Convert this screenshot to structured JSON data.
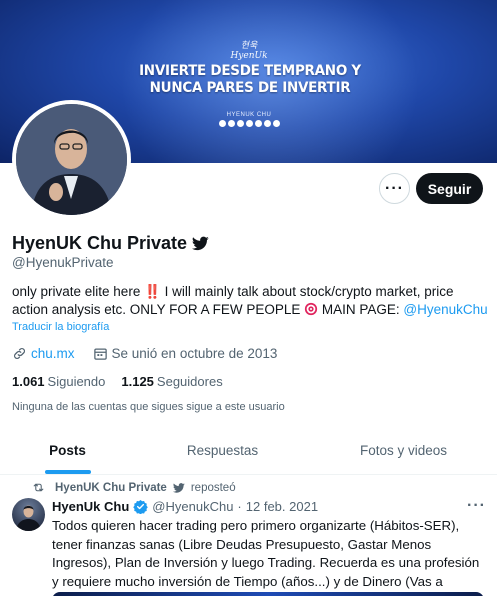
{
  "banner": {
    "logo_text": "현욱 HyenUk",
    "headline_line1": "INVIERTE DESDE TEMPRANO Y",
    "headline_line2": "NUNCA PARES DE INVERTIR",
    "brand_text": "HYENUK CHU"
  },
  "profile": {
    "display_name": "HyenUK Chu Private",
    "handle": "@HyenukPrivate",
    "bio_part1": "only private elite here ",
    "bio_bang": "‼️",
    "bio_part2": " I will mainly talk about stock/crypto market, price action analysis etc. ONLY FOR A FEW PEOPLE ",
    "bio_part3": " MAIN PAGE: ",
    "bio_mention": "@HyenukChu",
    "translate_label": "Traducir la biografía",
    "website": "chu.mx",
    "joined": "Se unió en octubre de 2013",
    "following_count": "1.061",
    "following_label": "Siguiendo",
    "followers_count": "1.125",
    "followers_label": "Seguidores",
    "followers_note": "Ninguna de las cuentas que sigues sigue a este usuario"
  },
  "actions": {
    "more_label": "···",
    "follow_label": "Seguir"
  },
  "tabs": [
    {
      "label": "Posts",
      "active": true
    },
    {
      "label": "Respuestas",
      "active": false
    },
    {
      "label": "Fotos y videos",
      "active": false
    }
  ],
  "tweet": {
    "retweeted_by": "HyenUK Chu Private",
    "reposted_label": "reposteó",
    "author_name": "HyenUk Chu",
    "author_handle": "@HyenukChu",
    "separator": "·",
    "date": "12 feb. 2021",
    "more_label": "···",
    "text": "Todos quieren hacer trading pero primero organizarte (Hábitos-SER), tener finanzas sanas (Libre Deudas Presupuesto, Gastar Menos Ingresos), Plan de Inversión y luego Trading. Recuerda es una profesión y requiere mucho inversión de Tiempo (años...) y de Dinero (Vas a perder mucho)"
  },
  "colors": {
    "accent": "#1d9bf0",
    "text_primary": "#0f1419",
    "text_secondary": "#536471",
    "follow_button": "#0f1419",
    "banner_blue": "#1f47a8"
  }
}
